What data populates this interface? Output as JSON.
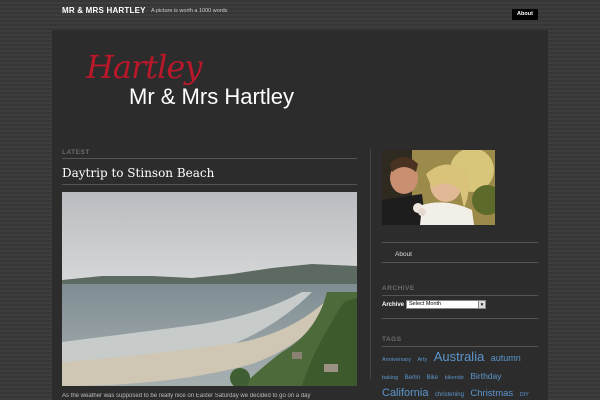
{
  "site": {
    "title": "MR & MRS HARTLEY",
    "tagline": "A picture is worth a 1000 words",
    "about_button": "About"
  },
  "header": {
    "logo_script": "Hartley",
    "logo_main": "Mr & Mrs Hartley"
  },
  "main": {
    "section_label": "LATEST",
    "post_title": "Daytrip to Stinson Beach",
    "post_excerpt": "As the weather was supposed to be really nice on Easter Saturday we decided to go on a day"
  },
  "sidebar": {
    "pages": [
      "About"
    ],
    "archive": {
      "heading": "ARCHIVE",
      "label": "Archive",
      "selected": "Select Month"
    },
    "tags": {
      "heading": "TAGS",
      "items": [
        {
          "name": "Anniversary",
          "size": 5.5
        },
        {
          "name": "Arty",
          "size": 5.5
        },
        {
          "name": "Australia",
          "size": 13
        },
        {
          "name": "autumn",
          "size": 9
        },
        {
          "name": "baking",
          "size": 5.5
        },
        {
          "name": "Berlin",
          "size": 6
        },
        {
          "name": "Bike",
          "size": 6
        },
        {
          "name": "bikeride",
          "size": 5.5
        },
        {
          "name": "Birthday",
          "size": 8.5
        },
        {
          "name": "California",
          "size": 11
        },
        {
          "name": "christening",
          "size": 6
        },
        {
          "name": "Christmas",
          "size": 9.5
        },
        {
          "name": "DIY",
          "size": 5.5
        }
      ],
      "color": "#5c95cc"
    }
  },
  "colors": {
    "background": "#3b3b3b",
    "panel": "#2c2c2c",
    "logo_accent": "#b8182a",
    "link": "#5c95cc"
  }
}
